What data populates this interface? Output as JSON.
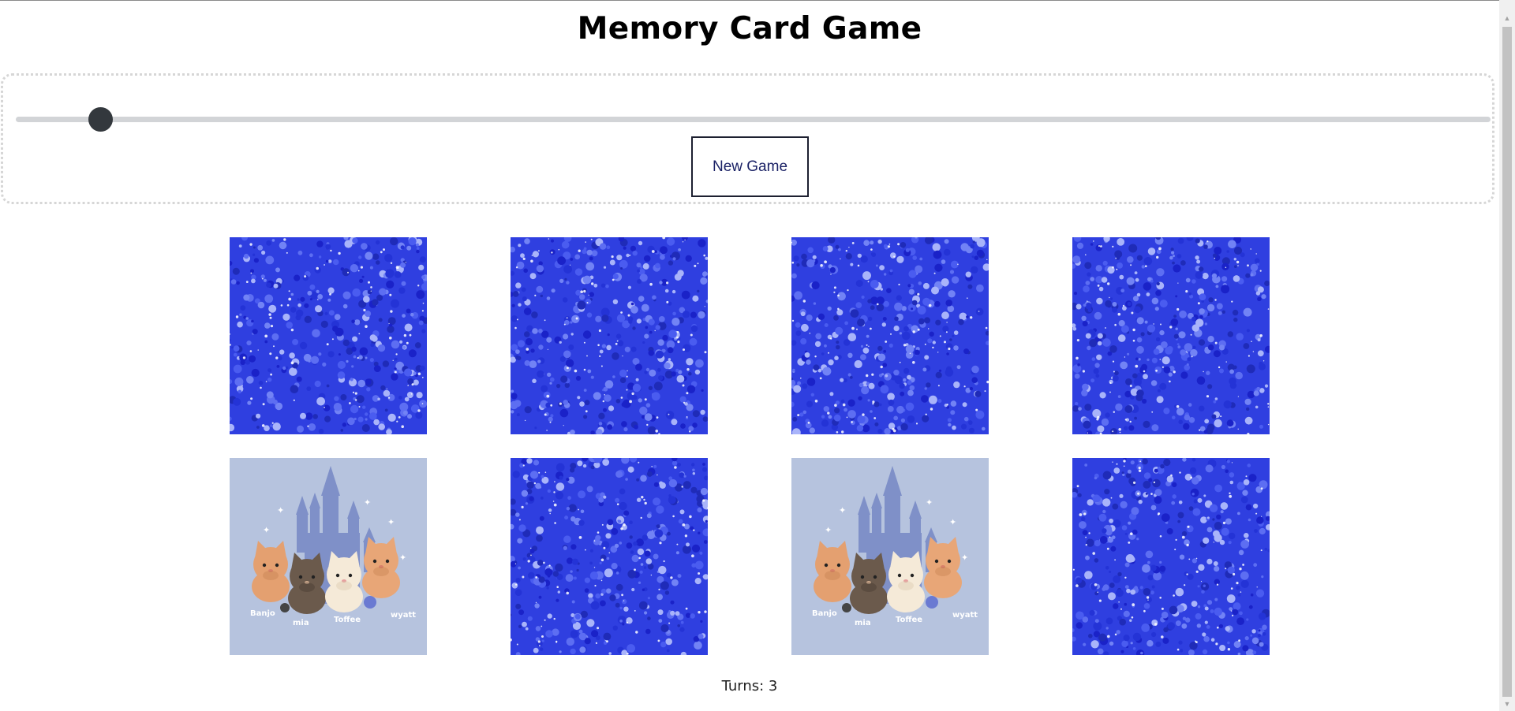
{
  "header": {
    "title": "Memory Card Game"
  },
  "controls": {
    "slider_value_fraction": 0.05,
    "new_game_label": "New Game"
  },
  "cards": [
    {
      "state": "face-down"
    },
    {
      "state": "face-down"
    },
    {
      "state": "face-down"
    },
    {
      "state": "face-down"
    },
    {
      "state": "face-up",
      "image_names": [
        "Banjo",
        "mia",
        "Toffee",
        "wyatt"
      ]
    },
    {
      "state": "face-down"
    },
    {
      "state": "face-up",
      "image_names": [
        "Banjo",
        "mia",
        "Toffee",
        "wyatt"
      ]
    },
    {
      "state": "face-down"
    }
  ],
  "status": {
    "turns_label": "Turns: 3"
  },
  "colors": {
    "card_back": "#2f3fe0",
    "card_face_bg": "#b6c3de",
    "slider_thumb": "#33383d"
  }
}
